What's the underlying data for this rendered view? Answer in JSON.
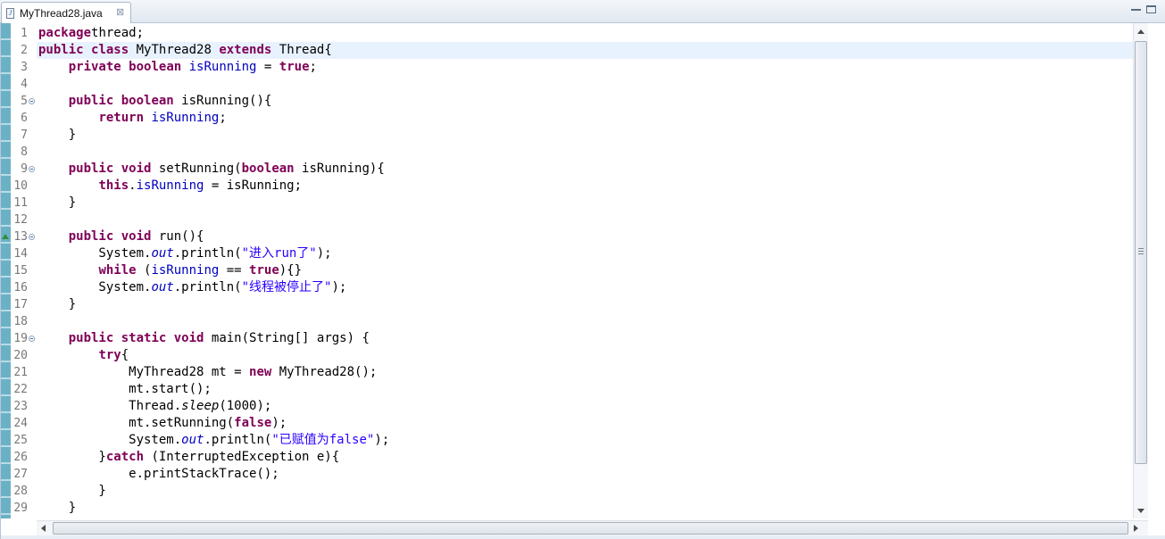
{
  "tab": {
    "file_icon": "java-file-icon",
    "title": "MyThread28.java",
    "close_glyph": "⊠"
  },
  "window_controls": [
    "minimize-icon",
    "maximize-icon"
  ],
  "editor": {
    "current_line": 2,
    "lines": [
      {
        "n": "1",
        "tokens": [
          [
            "kw",
            "package"
          ],
          [
            "",
            "thread;"
          ]
        ]
      },
      {
        "n": "2",
        "tokens": [
          [
            "kw",
            "public"
          ],
          [
            "",
            " "
          ],
          [
            "kw",
            "class"
          ],
          [
            "",
            " MyThread28 "
          ],
          [
            "kw",
            "extends"
          ],
          [
            "",
            " Thread{"
          ]
        ]
      },
      {
        "n": "3",
        "tokens": [
          [
            "",
            "    "
          ],
          [
            "kw",
            "private"
          ],
          [
            "",
            " "
          ],
          [
            "kw",
            "boolean"
          ],
          [
            "",
            " "
          ],
          [
            "fld",
            "isRunning"
          ],
          [
            "",
            " = "
          ],
          [
            "kw",
            "true"
          ],
          [
            "",
            ";"
          ]
        ]
      },
      {
        "n": "4",
        "tokens": []
      },
      {
        "n": "5",
        "fold": true,
        "tokens": [
          [
            "",
            "    "
          ],
          [
            "kw",
            "public"
          ],
          [
            "",
            " "
          ],
          [
            "kw",
            "boolean"
          ],
          [
            "",
            " isRunning(){"
          ]
        ]
      },
      {
        "n": "6",
        "tokens": [
          [
            "",
            "        "
          ],
          [
            "kw",
            "return"
          ],
          [
            "",
            " "
          ],
          [
            "fld",
            "isRunning"
          ],
          [
            "",
            ";"
          ]
        ]
      },
      {
        "n": "7",
        "tokens": [
          [
            "",
            "    }"
          ]
        ]
      },
      {
        "n": "8",
        "tokens": []
      },
      {
        "n": "9",
        "fold": true,
        "tokens": [
          [
            "",
            "    "
          ],
          [
            "kw",
            "public"
          ],
          [
            "",
            " "
          ],
          [
            "kw",
            "void"
          ],
          [
            "",
            " setRunning("
          ],
          [
            "kw",
            "boolean"
          ],
          [
            "",
            " isRunning){"
          ]
        ]
      },
      {
        "n": "10",
        "tokens": [
          [
            "",
            "        "
          ],
          [
            "kw",
            "this"
          ],
          [
            "",
            "."
          ],
          [
            "fld",
            "isRunning"
          ],
          [
            "",
            " = isRunning;"
          ]
        ]
      },
      {
        "n": "11",
        "tokens": [
          [
            "",
            "    }"
          ]
        ]
      },
      {
        "n": "12",
        "tokens": []
      },
      {
        "n": "13",
        "fold": true,
        "override": true,
        "tokens": [
          [
            "",
            "    "
          ],
          [
            "kw",
            "public"
          ],
          [
            "",
            " "
          ],
          [
            "kw",
            "void"
          ],
          [
            "",
            " run(){"
          ]
        ]
      },
      {
        "n": "14",
        "tokens": [
          [
            "",
            "        System."
          ],
          [
            "st",
            "out"
          ],
          [
            "",
            ".println("
          ],
          [
            "str",
            "\"进入run了\""
          ],
          [
            "",
            ");"
          ]
        ]
      },
      {
        "n": "15",
        "tokens": [
          [
            "",
            "        "
          ],
          [
            "kw",
            "while"
          ],
          [
            "",
            " ("
          ],
          [
            "fld",
            "isRunning"
          ],
          [
            "",
            " == "
          ],
          [
            "kw",
            "true"
          ],
          [
            "",
            "){}"
          ]
        ]
      },
      {
        "n": "16",
        "tokens": [
          [
            "",
            "        System."
          ],
          [
            "st",
            "out"
          ],
          [
            "",
            ".println("
          ],
          [
            "str",
            "\"线程被停止了\""
          ],
          [
            "",
            ");"
          ]
        ]
      },
      {
        "n": "17",
        "tokens": [
          [
            "",
            "    }"
          ]
        ]
      },
      {
        "n": "18",
        "tokens": []
      },
      {
        "n": "19",
        "fold": true,
        "tokens": [
          [
            "",
            "    "
          ],
          [
            "kw",
            "public"
          ],
          [
            "",
            " "
          ],
          [
            "kw",
            "static"
          ],
          [
            "",
            " "
          ],
          [
            "kw",
            "void"
          ],
          [
            "",
            " main(String[] args) {"
          ]
        ]
      },
      {
        "n": "20",
        "tokens": [
          [
            "",
            "        "
          ],
          [
            "kw",
            "try"
          ],
          [
            "",
            "{"
          ]
        ]
      },
      {
        "n": "21",
        "tokens": [
          [
            "",
            "            MyThread28 mt = "
          ],
          [
            "kw",
            "new"
          ],
          [
            "",
            " MyThread28();"
          ]
        ]
      },
      {
        "n": "22",
        "tokens": [
          [
            "",
            "            mt.start();"
          ]
        ]
      },
      {
        "n": "23",
        "tokens": [
          [
            "",
            "            Thread."
          ],
          [
            "sm",
            "sleep"
          ],
          [
            "",
            "(1000);"
          ]
        ]
      },
      {
        "n": "24",
        "tokens": [
          [
            "",
            "            mt.setRunning("
          ],
          [
            "kw",
            "false"
          ],
          [
            "",
            ");"
          ]
        ]
      },
      {
        "n": "25",
        "tokens": [
          [
            "",
            "            System."
          ],
          [
            "st",
            "out"
          ],
          [
            "",
            ".println("
          ],
          [
            "str",
            "\"已赋值为false\""
          ],
          [
            "",
            ");"
          ]
        ]
      },
      {
        "n": "26",
        "tokens": [
          [
            "",
            "        }"
          ],
          [
            "kw",
            "catch"
          ],
          [
            "",
            " (InterruptedException e){"
          ]
        ]
      },
      {
        "n": "27",
        "tokens": [
          [
            "",
            "            e.printStackTrace();"
          ]
        ]
      },
      {
        "n": "28",
        "tokens": [
          [
            "",
            "        }"
          ]
        ]
      },
      {
        "n": "29",
        "tokens": [
          [
            "",
            "    }"
          ]
        ]
      }
    ]
  },
  "scrollbars": {
    "vertical": {
      "up_icon": "scroll-up-arrow-icon",
      "down_icon": "scroll-down-arrow-icon",
      "grip_icon": "grip-icon"
    },
    "horizontal": {
      "left_icon": "scroll-left-arrow-icon",
      "right_icon": "scroll-right-arrow-icon"
    }
  }
}
